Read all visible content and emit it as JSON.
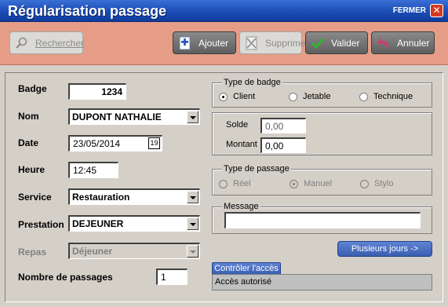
{
  "window": {
    "title": "Régularisation passage",
    "close_label": "FERMER",
    "close_glyph": "✕"
  },
  "toolbar": {
    "rechercher": "Rechercher",
    "ajouter": "Ajouter",
    "supprimer": "Supprimer",
    "valider": "Valider",
    "annuler": "Annuler"
  },
  "form": {
    "badge": {
      "label": "Badge",
      "value": "1234"
    },
    "nom": {
      "label": "Nom",
      "value": "DUPONT NATHALIE"
    },
    "date": {
      "label": "Date",
      "value": "23/05/2014",
      "calendar_glyph": "19"
    },
    "heure": {
      "label": "Heure",
      "value": "12:45"
    },
    "service": {
      "label": "Service",
      "value": "Restauration"
    },
    "prestation": {
      "label": "Prestation",
      "value": "DEJEUNER"
    },
    "repas": {
      "label": "Repas",
      "value": "Déjeuner"
    },
    "nb_passages": {
      "label": "Nombre de passages",
      "value": "1"
    }
  },
  "type_badge": {
    "title": "Type de badge",
    "options": [
      "Client",
      "Jetable",
      "Technique"
    ],
    "selected": "Client"
  },
  "solde": {
    "solde_label": "Solde",
    "solde_value": "0,00",
    "montant_label": "Montant",
    "montant_value": "0,00"
  },
  "type_passage": {
    "title": "Type de passage",
    "options": [
      "Réel",
      "Manuel",
      "Stylo"
    ],
    "selected": "Manuel"
  },
  "message": {
    "title": "Message",
    "value": ""
  },
  "plusieurs_jours": "Plusieurs jours ->",
  "access": {
    "button": "Contrôler l'accès",
    "status": "Accès autorisé"
  },
  "colors": {
    "titlebar": "#1d4fb8",
    "toolbar": "#e59d88",
    "panel": "#d4d0c8",
    "blue_button": "#3a5fb0"
  }
}
